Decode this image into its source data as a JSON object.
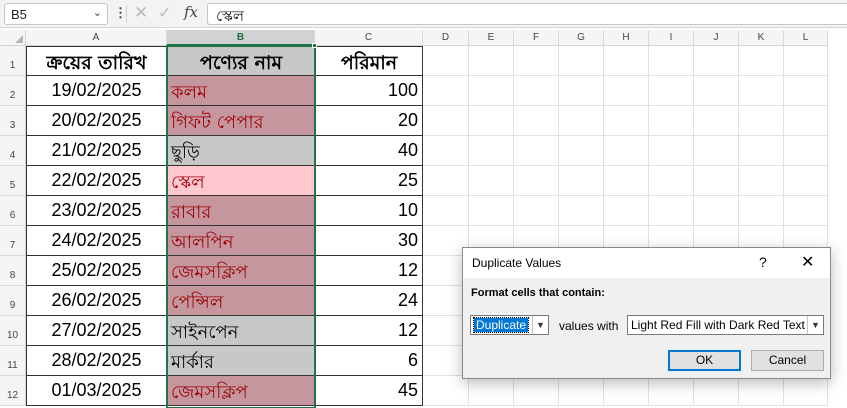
{
  "formula_bar": {
    "name_box": "B5",
    "more_dots": "⋮",
    "cancel_glyph": "✕",
    "enter_glyph": "✓",
    "fx": "fx",
    "content": "স্কেল"
  },
  "columns": [
    "A",
    "B",
    "C",
    "D",
    "E",
    "F",
    "G",
    "H",
    "I",
    "J",
    "K",
    "L"
  ],
  "rows": [
    "1",
    "2",
    "3",
    "4",
    "5",
    "6",
    "7",
    "8",
    "9",
    "10",
    "11",
    "12"
  ],
  "table": {
    "headers": [
      "ক্রয়ের তারিখ",
      "পণ্যের নাম",
      "পরিমান"
    ],
    "rows": [
      {
        "date": "19/02/2025",
        "product": "কলম",
        "qty": "100",
        "dup": true
      },
      {
        "date": "20/02/2025",
        "product": "গিফট পেপার",
        "qty": "20",
        "dup": true
      },
      {
        "date": "21/02/2025",
        "product": "ছুড়ি",
        "qty": "40",
        "dup": false
      },
      {
        "date": "22/02/2025",
        "product": "স্কেল",
        "qty": "25",
        "dup": true
      },
      {
        "date": "23/02/2025",
        "product": "রাবার",
        "qty": "10",
        "dup": true
      },
      {
        "date": "24/02/2025",
        "product": "আলপিন",
        "qty": "30",
        "dup": true
      },
      {
        "date": "25/02/2025",
        "product": "জেমসক্লিপ",
        "qty": "12",
        "dup": true
      },
      {
        "date": "26/02/2025",
        "product": "পেন্সিল",
        "qty": "24",
        "dup": true
      },
      {
        "date": "27/02/2025",
        "product": "সাইনপেন",
        "qty": "12",
        "dup": false
      },
      {
        "date": "28/02/2025",
        "product": "মার্কার",
        "qty": "6",
        "dup": false
      },
      {
        "date": "01/03/2025",
        "product": "জেমসক্লিপ",
        "qty": "45",
        "dup": true
      }
    ]
  },
  "colors": {
    "header_fill": "#c0c0c0",
    "selected_fill": "#c8c8c8",
    "dup_fill": "#c5969d",
    "dup_text": "#9c0006",
    "active_dup_fill": "#ffc7ce",
    "plain_text": "#000000",
    "accent": "#217346"
  },
  "dialog": {
    "title": "Duplicate Values",
    "help": "?",
    "close": "✕",
    "label": "Format cells that contain:",
    "rule_value": "Duplicate",
    "middle_text": "values with",
    "format_value": "Light Red Fill with Dark Red Text",
    "ok": "OK",
    "cancel": "Cancel"
  },
  "icons": {
    "name_box_dropdown": "chevron-down-icon",
    "combo_arrow": "chevron-down-icon",
    "fill_handle": "fill-handle"
  }
}
